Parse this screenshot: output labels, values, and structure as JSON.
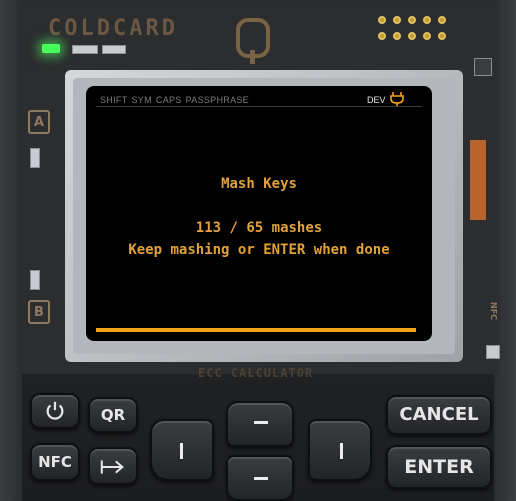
{
  "device": {
    "brand": "COLDCARD",
    "brand_mark": "Q",
    "keyboard_label": "ECC CALCULATOR",
    "pcb_labels": [
      "A",
      "B"
    ],
    "nfc_label": "NFC"
  },
  "status_bar": {
    "flags": [
      "SHIFT",
      "SYM",
      "CAPS",
      "PASSPHRASE"
    ],
    "dev_label": "DEV",
    "power_icon": "plug-icon",
    "accent": "#f5a31b"
  },
  "screen": {
    "title": "Mash Keys",
    "count_line": "113 / 65 mashes",
    "hint_line": "Keep mashing or ENTER when done",
    "progress": 1.0,
    "text_color": "#e2a23a"
  },
  "keys": {
    "power_icon": "power-icon",
    "qr": "QR",
    "nfc": "NFC",
    "tab_icon": "tab-arrow-icon",
    "cancel": "CANCEL",
    "enter": "ENTER"
  }
}
